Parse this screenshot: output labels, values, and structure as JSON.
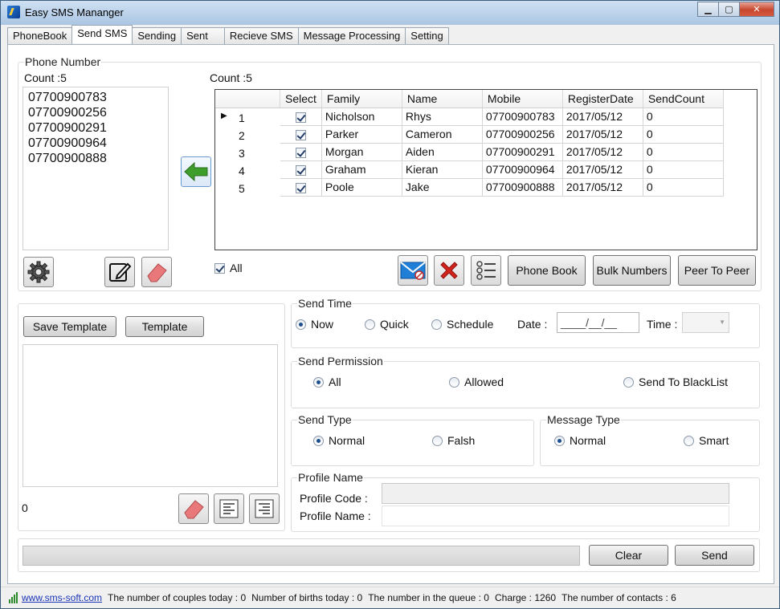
{
  "window": {
    "title": "Easy SMS Mananger"
  },
  "tabs": [
    "PhoneBook",
    "Send SMS",
    "Sending",
    "Sent",
    "Recieve SMS",
    "Message Processing",
    "Setting"
  ],
  "phone_panel": {
    "title": "Phone Number",
    "count_label": "Count :5",
    "numbers": [
      "07700900783",
      "07700900256",
      "07700900291",
      "07700900964",
      "07700900888"
    ]
  },
  "grid": {
    "count_label": "Count :5",
    "columns": [
      "Select",
      "Family",
      "Name",
      "Mobile",
      "RegisterDate",
      "SendCount"
    ],
    "rows": [
      {
        "num": "1",
        "family": "Nicholson",
        "name": "Rhys",
        "mobile": "07700900783",
        "date": "2017/05/12",
        "count": "0"
      },
      {
        "num": "2",
        "family": "Parker",
        "name": "Cameron",
        "mobile": "07700900256",
        "date": "2017/05/12",
        "count": "0"
      },
      {
        "num": "3",
        "family": "Morgan",
        "name": "Aiden",
        "mobile": "07700900291",
        "date": "2017/05/12",
        "count": "0"
      },
      {
        "num": "4",
        "family": "Graham",
        "name": "Kieran",
        "mobile": "07700900964",
        "date": "2017/05/12",
        "count": "0"
      },
      {
        "num": "5",
        "family": "Poole",
        "name": "Jake",
        "mobile": "07700900888",
        "date": "2017/05/12",
        "count": "0"
      }
    ],
    "all_label": "All"
  },
  "toolbar": {
    "phone_book": "Phone Book",
    "bulk_numbers": "Bulk Numbers",
    "peer_to_peer": "Peer To Peer"
  },
  "template": {
    "save_label": "Save Template",
    "template_label": "Template",
    "char_count": "0"
  },
  "send_time": {
    "title": "Send Time",
    "options": [
      "Now",
      "Quick",
      "Schedule"
    ],
    "selected": "Now",
    "date_label": "Date :",
    "date_value": "____/__/__",
    "time_label": "Time :"
  },
  "send_permission": {
    "title": "Send Permission",
    "options": [
      "All",
      "Allowed",
      "Send To BlackList"
    ],
    "selected": "All"
  },
  "send_type": {
    "title": "Send Type",
    "options": [
      "Normal",
      "Falsh"
    ],
    "selected": "Normal"
  },
  "message_type": {
    "title": "Message Type",
    "options": [
      "Normal",
      "Smart"
    ],
    "selected": "Normal"
  },
  "profile": {
    "title": "Profile Name",
    "code_label": "Profile Code :",
    "name_label": "Profile Name :"
  },
  "actions": {
    "clear": "Clear",
    "send": "Send"
  },
  "status": {
    "link": "www.sms-soft.com",
    "couples": "The number of couples today : 0",
    "births": "Number of births today : 0",
    "queue": "The number in the queue : 0",
    "charge": "Charge : 1260",
    "contacts": "The number of contacts : 6"
  },
  "colors": {
    "arrow_green": "#3f9e2b",
    "delete_red": "#d3241c",
    "eraser": "#e8787a",
    "title_blue": "#b9d1ea"
  }
}
